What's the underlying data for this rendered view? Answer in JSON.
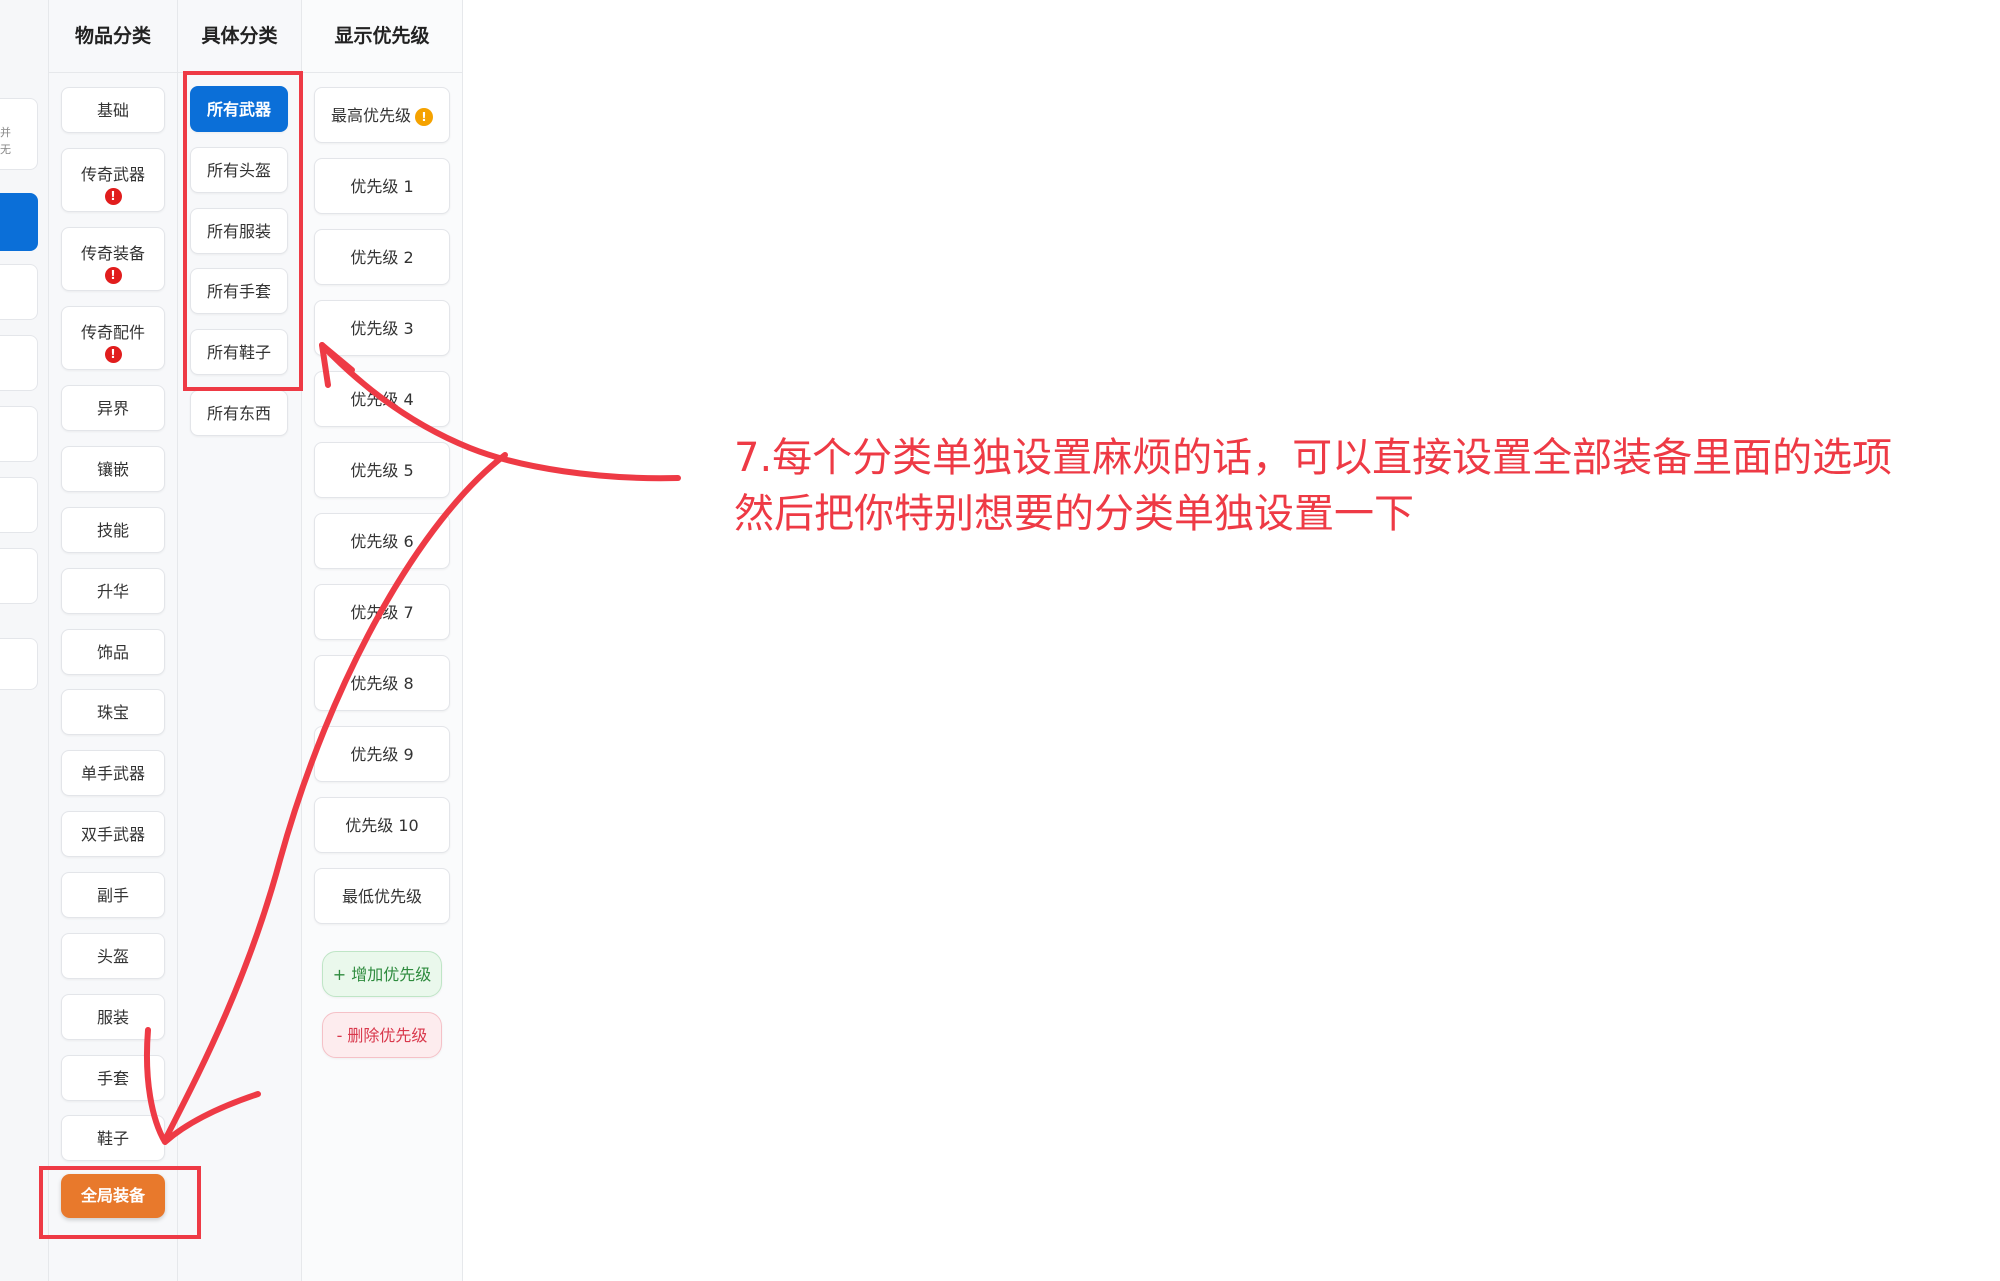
{
  "headers": {
    "category": "物品分类",
    "subcategory": "具体分类",
    "priority": "显示优先级"
  },
  "left_strip_text": [
    "并",
    "无"
  ],
  "categories": [
    {
      "label": "基础",
      "badge": null
    },
    {
      "label": "传奇武器",
      "badge": "!"
    },
    {
      "label": "传奇装备",
      "badge": "!"
    },
    {
      "label": "传奇配件",
      "badge": "!"
    },
    {
      "label": "异界",
      "badge": null
    },
    {
      "label": "镶嵌",
      "badge": null
    },
    {
      "label": "技能",
      "badge": null
    },
    {
      "label": "升华",
      "badge": null
    },
    {
      "label": "饰品",
      "badge": null
    },
    {
      "label": "珠宝",
      "badge": null
    },
    {
      "label": "单手武器",
      "badge": null
    },
    {
      "label": "双手武器",
      "badge": null
    },
    {
      "label": "副手",
      "badge": null
    },
    {
      "label": "头盔",
      "badge": null
    },
    {
      "label": "服装",
      "badge": null
    },
    {
      "label": "手套",
      "badge": null
    },
    {
      "label": "鞋子",
      "badge": null
    }
  ],
  "global_button": "全局装备",
  "subcategories": [
    {
      "label": "所有武器",
      "active": true
    },
    {
      "label": "所有头盔",
      "active": false
    },
    {
      "label": "所有服装",
      "active": false
    },
    {
      "label": "所有手套",
      "active": false
    },
    {
      "label": "所有鞋子",
      "active": false
    },
    {
      "label": "所有东西",
      "active": false
    }
  ],
  "priorities": {
    "highest": "最高优先级",
    "highest_badge": "!",
    "levels": [
      "优先级 1",
      "优先级 2",
      "优先级 3",
      "优先级 4",
      "优先级 5",
      "优先级 6",
      "优先级 7",
      "优先级 8",
      "优先级 9",
      "优先级 10"
    ],
    "lowest": "最低优先级",
    "add": "+ 增加优先级",
    "delete": "- 删除优先级"
  },
  "annotation": {
    "line1": "7.每个分类单独设置麻烦的话，可以直接设置全部装备里面的选项",
    "line2": "然后把你特别想要的分类单独设置一下",
    "color": "#ee3a45"
  },
  "colors": {
    "active_blue": "#0b6fd8",
    "global_orange": "#e8792c",
    "badge_red": "#e11d1d",
    "badge_orange": "#f5a200"
  }
}
